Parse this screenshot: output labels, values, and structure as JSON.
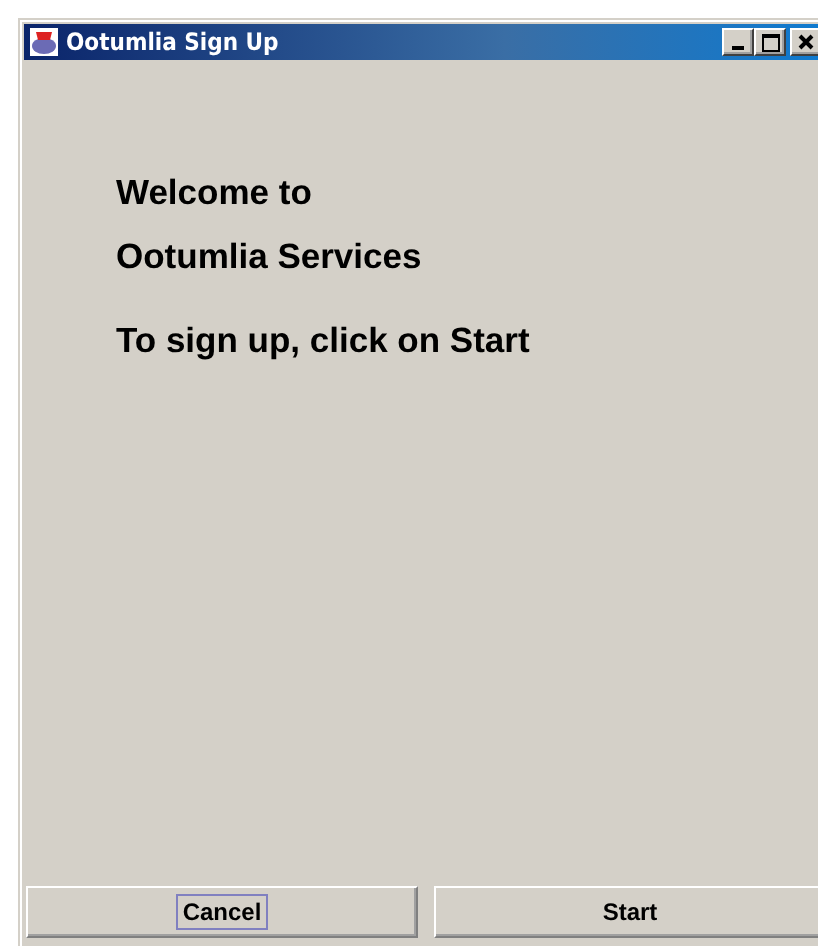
{
  "window": {
    "title": "Ootumlia Sign Up"
  },
  "messages": [
    "Welcome to",
    "Ootumlia Services",
    "To sign up, click on Start"
  ],
  "buttons": [
    {
      "label": "Cancel",
      "focused": true
    },
    {
      "label": "Start",
      "focused": false
    }
  ]
}
